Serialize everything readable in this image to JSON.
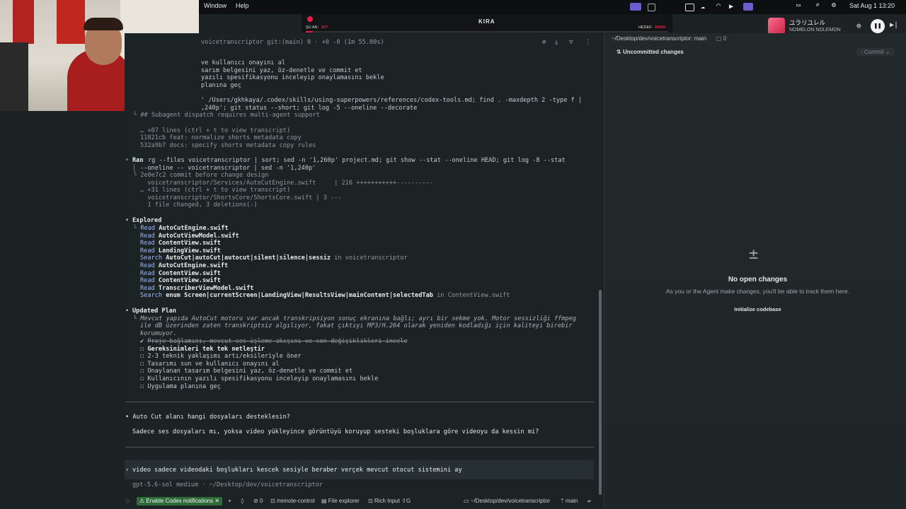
{
  "menubar": {
    "window_label": "Window",
    "help_label": "Help",
    "clock": "Sat Aug 1  13:20"
  },
  "kira": {
    "title": "KIRA",
    "now_label": "ŞU AN:",
    "now_value": "207",
    "target_label": "HEDEF:",
    "target_value": "10000"
  },
  "now_playing": {
    "title": "ユラリユレル",
    "artist": "NOMELON NOLEMON"
  },
  "terminal": {
    "header": "voicetranscriptor git:(main) 0 · +0 -0 (1m 55.00s)",
    "lines_top": [
      "ve kullanıcı onayını al",
      "sarım belgesini yaz, öz-denetle ve commit et",
      "yazılı spesifikasyonu inceleyip onaylamasını bekle",
      "planına geç"
    ],
    "cmd1_line1": "' /Users/gkhkaya/.codex/skills/using-superpowers/references/codex-tools.md; find . -maxdepth 2 -type f |",
    "cmd1_line2": ",240p'; git status --short; git log -5 --oneline --decorate",
    "cmd1_out1": "└ ## Subagent dispatch requires multi-agent support",
    "cmd1_out2": "… +87 lines (ctrl + t to view transcript)",
    "cmd1_out3": "11821cb feat: normalize shorts metadata copy",
    "cmd1_out4": "532a9b7 docs: specify shorts metadata copy rules",
    "ran_label": "Ran",
    "ran_line1": "rg --files voicetranscriptor | sort; sed -n '1,260p' project.md; git show --stat --oneline HEAD; git log -8 --stat",
    "ran_line2": "--oneline -- voicetranscriptor | sed -n '1,240p'",
    "ran_out": [
      "└ 2e0e7c2 commit before change design",
      "  voicetranscriptor/Services/AutoCutEngine.swift     | 216 +++++++++++----------",
      "… +31 lines (ctrl + t to view transcript)",
      "  voicetranscriptor/ShortsCore/ShortsCore.swift | 3 ---",
      "  1 file changed, 3 deletions(-)"
    ],
    "explored_title": "Explored",
    "explored": [
      {
        "verb": "Read",
        "target": "AutoCutEngine.swift",
        "suffix": ""
      },
      {
        "verb": "Read",
        "target": "AutoCutViewModel.swift",
        "suffix": ""
      },
      {
        "verb": "Read",
        "target": "ContentView.swift",
        "suffix": ""
      },
      {
        "verb": "Read",
        "target": "LandingView.swift",
        "suffix": ""
      },
      {
        "verb": "Search",
        "target": "AutoCut|autoCut|autocut|silent|silence|sessiz",
        "suffix": " in voicetranscriptor"
      },
      {
        "verb": "Read",
        "target": "AutoCutEngine.swift",
        "suffix": ""
      },
      {
        "verb": "Read",
        "target": "ContentView.swift",
        "suffix": ""
      },
      {
        "verb": "Read",
        "target": "ContentView.swift",
        "suffix": ""
      },
      {
        "verb": "Read",
        "target": "TranscriberViewModel.swift",
        "suffix": ""
      },
      {
        "verb": "Search",
        "target": "enum Screen|currentScreen|LandingView|ResultsView|mainContent|selectedTab",
        "suffix": " in ContentView.swift"
      }
    ],
    "plan_title": "Updated Plan",
    "plan_note1": "└ Mevcut yapıda AutoCut motoru var ancak transkripsiyon sonuç ekranına bağlı; ayrı bir sekme yok. Motor sessizliği ffmpeg",
    "plan_note2": "ile dB üzerinden zaten transkriptsiz algılıyor, fakat çıktıyı MP3/H.264 olarak yeniden kodladığı için kaliteyi birebir",
    "plan_note3": "korumuyor.",
    "plan_items": [
      {
        "mark": "✔",
        "text": "Proje bağlamını, mevcut ses işleme akışını ve son değişiklikleri incele",
        "style": "done"
      },
      {
        "mark": "☐",
        "text": "Gereksinimleri tek tek netleştir",
        "style": "active"
      },
      {
        "mark": "☐",
        "text": "2-3 teknik yaklaşımı artı/eksileriyle öner",
        "style": "todo"
      },
      {
        "mark": "☐",
        "text": "Tasarımı sun ve kullanıcı onayını al",
        "style": "todo"
      },
      {
        "mark": "☐",
        "text": "Onaylanan tasarım belgesini yaz, öz-denetle ve commit et",
        "style": "todo"
      },
      {
        "mark": "☐",
        "text": "Kullanıcının yazılı spesifikasyonu inceleyip onaylamasını bekle",
        "style": "todo"
      },
      {
        "mark": "☐",
        "text": "Uygulama planına geç",
        "style": "todo"
      }
    ],
    "question": "• Auto Cut alanı hangi dosyaları desteklesin?",
    "question_detail": "Sadece ses dosyaları mı, yoksa video yükleyince görüntüyü koruyup sesteki boşluklara göre videoyu da kessin mi?",
    "prompt_text": "video sadece videodaki boşlukları kescek sesiyle beraber verçek mevcut otocut sistemini ay",
    "model_line": "gpt-5.6-sol medium · ~/Desktop/dev/voicetranscriptor"
  },
  "statusbar": {
    "notify_label": "Enable Codex notifications",
    "count": "0",
    "remote": "/remote-control",
    "explorer": "File explorer",
    "rich": "Rich Input",
    "path": "~/Desktop/dev/voicetranscriptor",
    "branch": "main"
  },
  "right": {
    "path_header": "~/Desktop/dev/voicetranscriptor: main",
    "file_count": "0",
    "uncommitted": "Uncommitted changes",
    "commit_label": "Commit",
    "empty_title": "No open changes",
    "empty_desc": "As you or the Agent make changes, you'll be able to track them here.",
    "init_label": "Initialize codebase"
  }
}
